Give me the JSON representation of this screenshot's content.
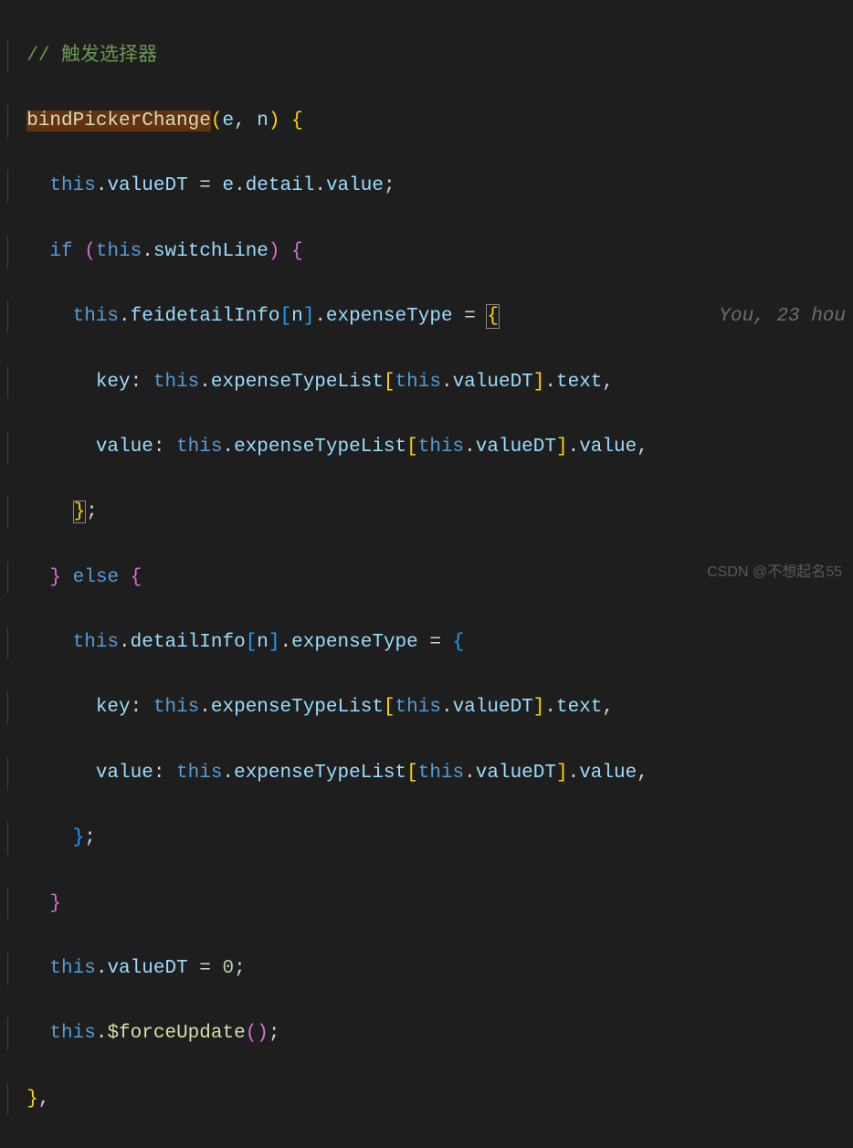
{
  "code": {
    "comment": "// 触发选择器",
    "func_name": "bindPickerChange",
    "param_e": "e",
    "param_n": "n",
    "kw_this1": "this",
    "prop_valueDT": "valueDT",
    "eq": " = ",
    "var_e": "e",
    "prop_detail": "detail",
    "prop_value": "value",
    "semi": ";",
    "kw_if": "if",
    "kw_this2": "this",
    "prop_switchLine": "switchLine",
    "kw_this3": "this",
    "prop_feidetailInfo": "feidetailInfo",
    "var_n": "n",
    "prop_expenseType": "expenseType",
    "blame": "You, 23 hou",
    "prop_key": "key",
    "colon": ": ",
    "prop_expenseTypeList": "expenseTypeList",
    "prop_text": "text",
    "comma": ",",
    "kw_else": "else",
    "prop_detailInfo": "detailInfo",
    "num_zero": "0",
    "method_forceUpdate": "$forceUpdate",
    "open_paren": "(",
    "close_paren": ")",
    "open_brace": "{",
    "close_brace": "}",
    "open_sq": "[",
    "close_sq": "]",
    "dot": "."
  },
  "watermark": "CSDN @不想起名55"
}
